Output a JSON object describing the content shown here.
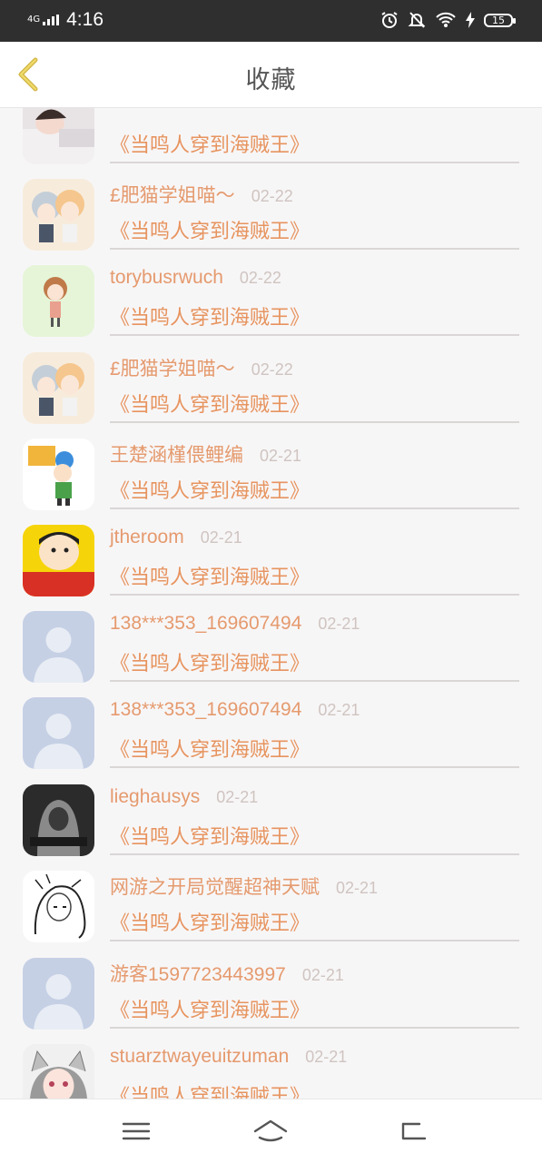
{
  "status_bar": {
    "network": "4G",
    "time": "4:16",
    "battery": "15"
  },
  "header": {
    "title": "收藏"
  },
  "items": [
    {
      "name": "",
      "date": "",
      "book": "《当鸣人穿到海贼王》",
      "avatar": "sleeping-girl-avatar"
    },
    {
      "name": "£肥猫学姐喵～",
      "date": "02-22",
      "book": "《当鸣人穿到海贼王》",
      "avatar": "anime-couple-avatar"
    },
    {
      "name": "torybusrwuch",
      "date": "02-22",
      "book": "《当鸣人穿到海贼王》",
      "avatar": "cartoon-girl-avatar"
    },
    {
      "name": "£肥猫学姐喵～",
      "date": "02-22",
      "book": "《当鸣人穿到海贼王》",
      "avatar": "anime-couple-avatar"
    },
    {
      "name": "王楚涵槿偎鲤编",
      "date": "02-21",
      "book": "《当鸣人穿到海贼王》",
      "avatar": "cartoon-kid-avatar"
    },
    {
      "name": "jtheroom",
      "date": "02-21",
      "book": "《当鸣人穿到海贼王》",
      "avatar": "crayon-shin-chan-avatar"
    },
    {
      "name": "138***353_169607494",
      "date": "02-21",
      "book": "《当鸣人穿到海贼王》",
      "avatar": "default-avatar"
    },
    {
      "name": "138***353_169607494",
      "date": "02-21",
      "book": "《当鸣人穿到海贼王》",
      "avatar": "default-avatar"
    },
    {
      "name": "lieghausys",
      "date": "02-21",
      "book": "《当鸣人穿到海贼王》",
      "avatar": "hooded-figure-avatar"
    },
    {
      "name": "网游之开局觉醒超神天赋",
      "date": "02-21",
      "book": "《当鸣人穿到海贼王》",
      "avatar": "sketch-girl-avatar"
    },
    {
      "name": "游客1597723443997",
      "date": "02-21",
      "book": "《当鸣人穿到海贼王》",
      "avatar": "default-avatar"
    },
    {
      "name": "stuarztwayeuitzuman",
      "date": "02-21",
      "book": "《当鸣人穿到海贼王》",
      "avatar": "cat-ear-girl-avatar"
    }
  ],
  "colors": {
    "name": "#e59a6e",
    "book": "#e7945f",
    "date": "#cfc4c0",
    "background": "#f7f6f7"
  }
}
